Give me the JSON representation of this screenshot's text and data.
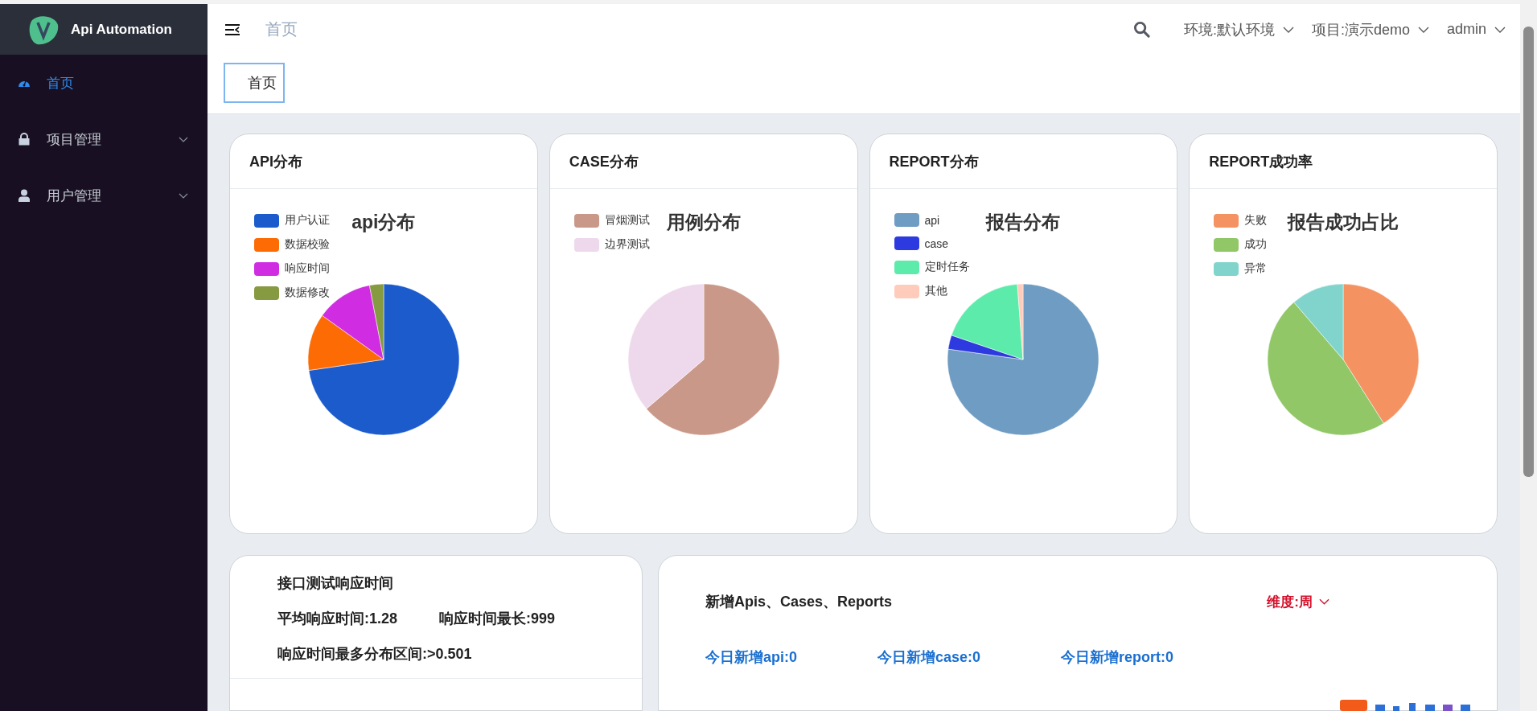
{
  "sidebar": {
    "app_name": "Api Automation",
    "items": [
      {
        "label": "首页",
        "selected": true,
        "expandable": false
      },
      {
        "label": "项目管理",
        "selected": false,
        "expandable": true
      },
      {
        "label": "用户管理",
        "selected": false,
        "expandable": true
      }
    ]
  },
  "header": {
    "breadcrumb": "首页",
    "environment": "环境:默认环境",
    "project": "项目:演示demo",
    "user": "admin"
  },
  "tags": [
    {
      "label": "首页",
      "selected": true
    }
  ],
  "pie_cards": [
    {
      "title": "API分布",
      "chart_title": "api分布",
      "legend": [
        {
          "label": "用户认证",
          "color": "#1b5bcc"
        },
        {
          "label": "数据校验",
          "color": "#fd6b05"
        },
        {
          "label": "响应时间",
          "color": "#d02de3"
        },
        {
          "label": "数据修改",
          "color": "#869a42"
        }
      ]
    },
    {
      "title": "CASE分布",
      "chart_title": "用例分布",
      "legend": [
        {
          "label": "冒烟测试",
          "color": "#c99888"
        },
        {
          "label": "边界测试",
          "color": "#eed8eb"
        }
      ]
    },
    {
      "title": "REPORT分布",
      "chart_title": "报告分布",
      "legend": [
        {
          "label": "api",
          "color": "#6f9cc2"
        },
        {
          "label": "case",
          "color": "#2c3ae0"
        },
        {
          "label": "定时任务",
          "color": "#5debac"
        },
        {
          "label": "其他",
          "color": "#ffcbbb"
        }
      ]
    },
    {
      "title": "REPORT成功率",
      "chart_title": "报告成功占比",
      "legend": [
        {
          "label": "失败",
          "color": "#f59262"
        },
        {
          "label": "成功",
          "color": "#91c767"
        },
        {
          "label": "异常",
          "color": "#80d4cb"
        }
      ]
    }
  ],
  "response_card": {
    "title": "接口测试响应时间",
    "average": "平均响应时间:1.28",
    "longest": "响应时间最长:999",
    "range": "响应时间最多分布区间:>0.501"
  },
  "new_card": {
    "title": "新增Apis、Cases、Reports",
    "dimension": "维度:周",
    "stats": [
      "今日新增api:0",
      "今日新增case:0",
      "今日新增report:0"
    ]
  }
}
